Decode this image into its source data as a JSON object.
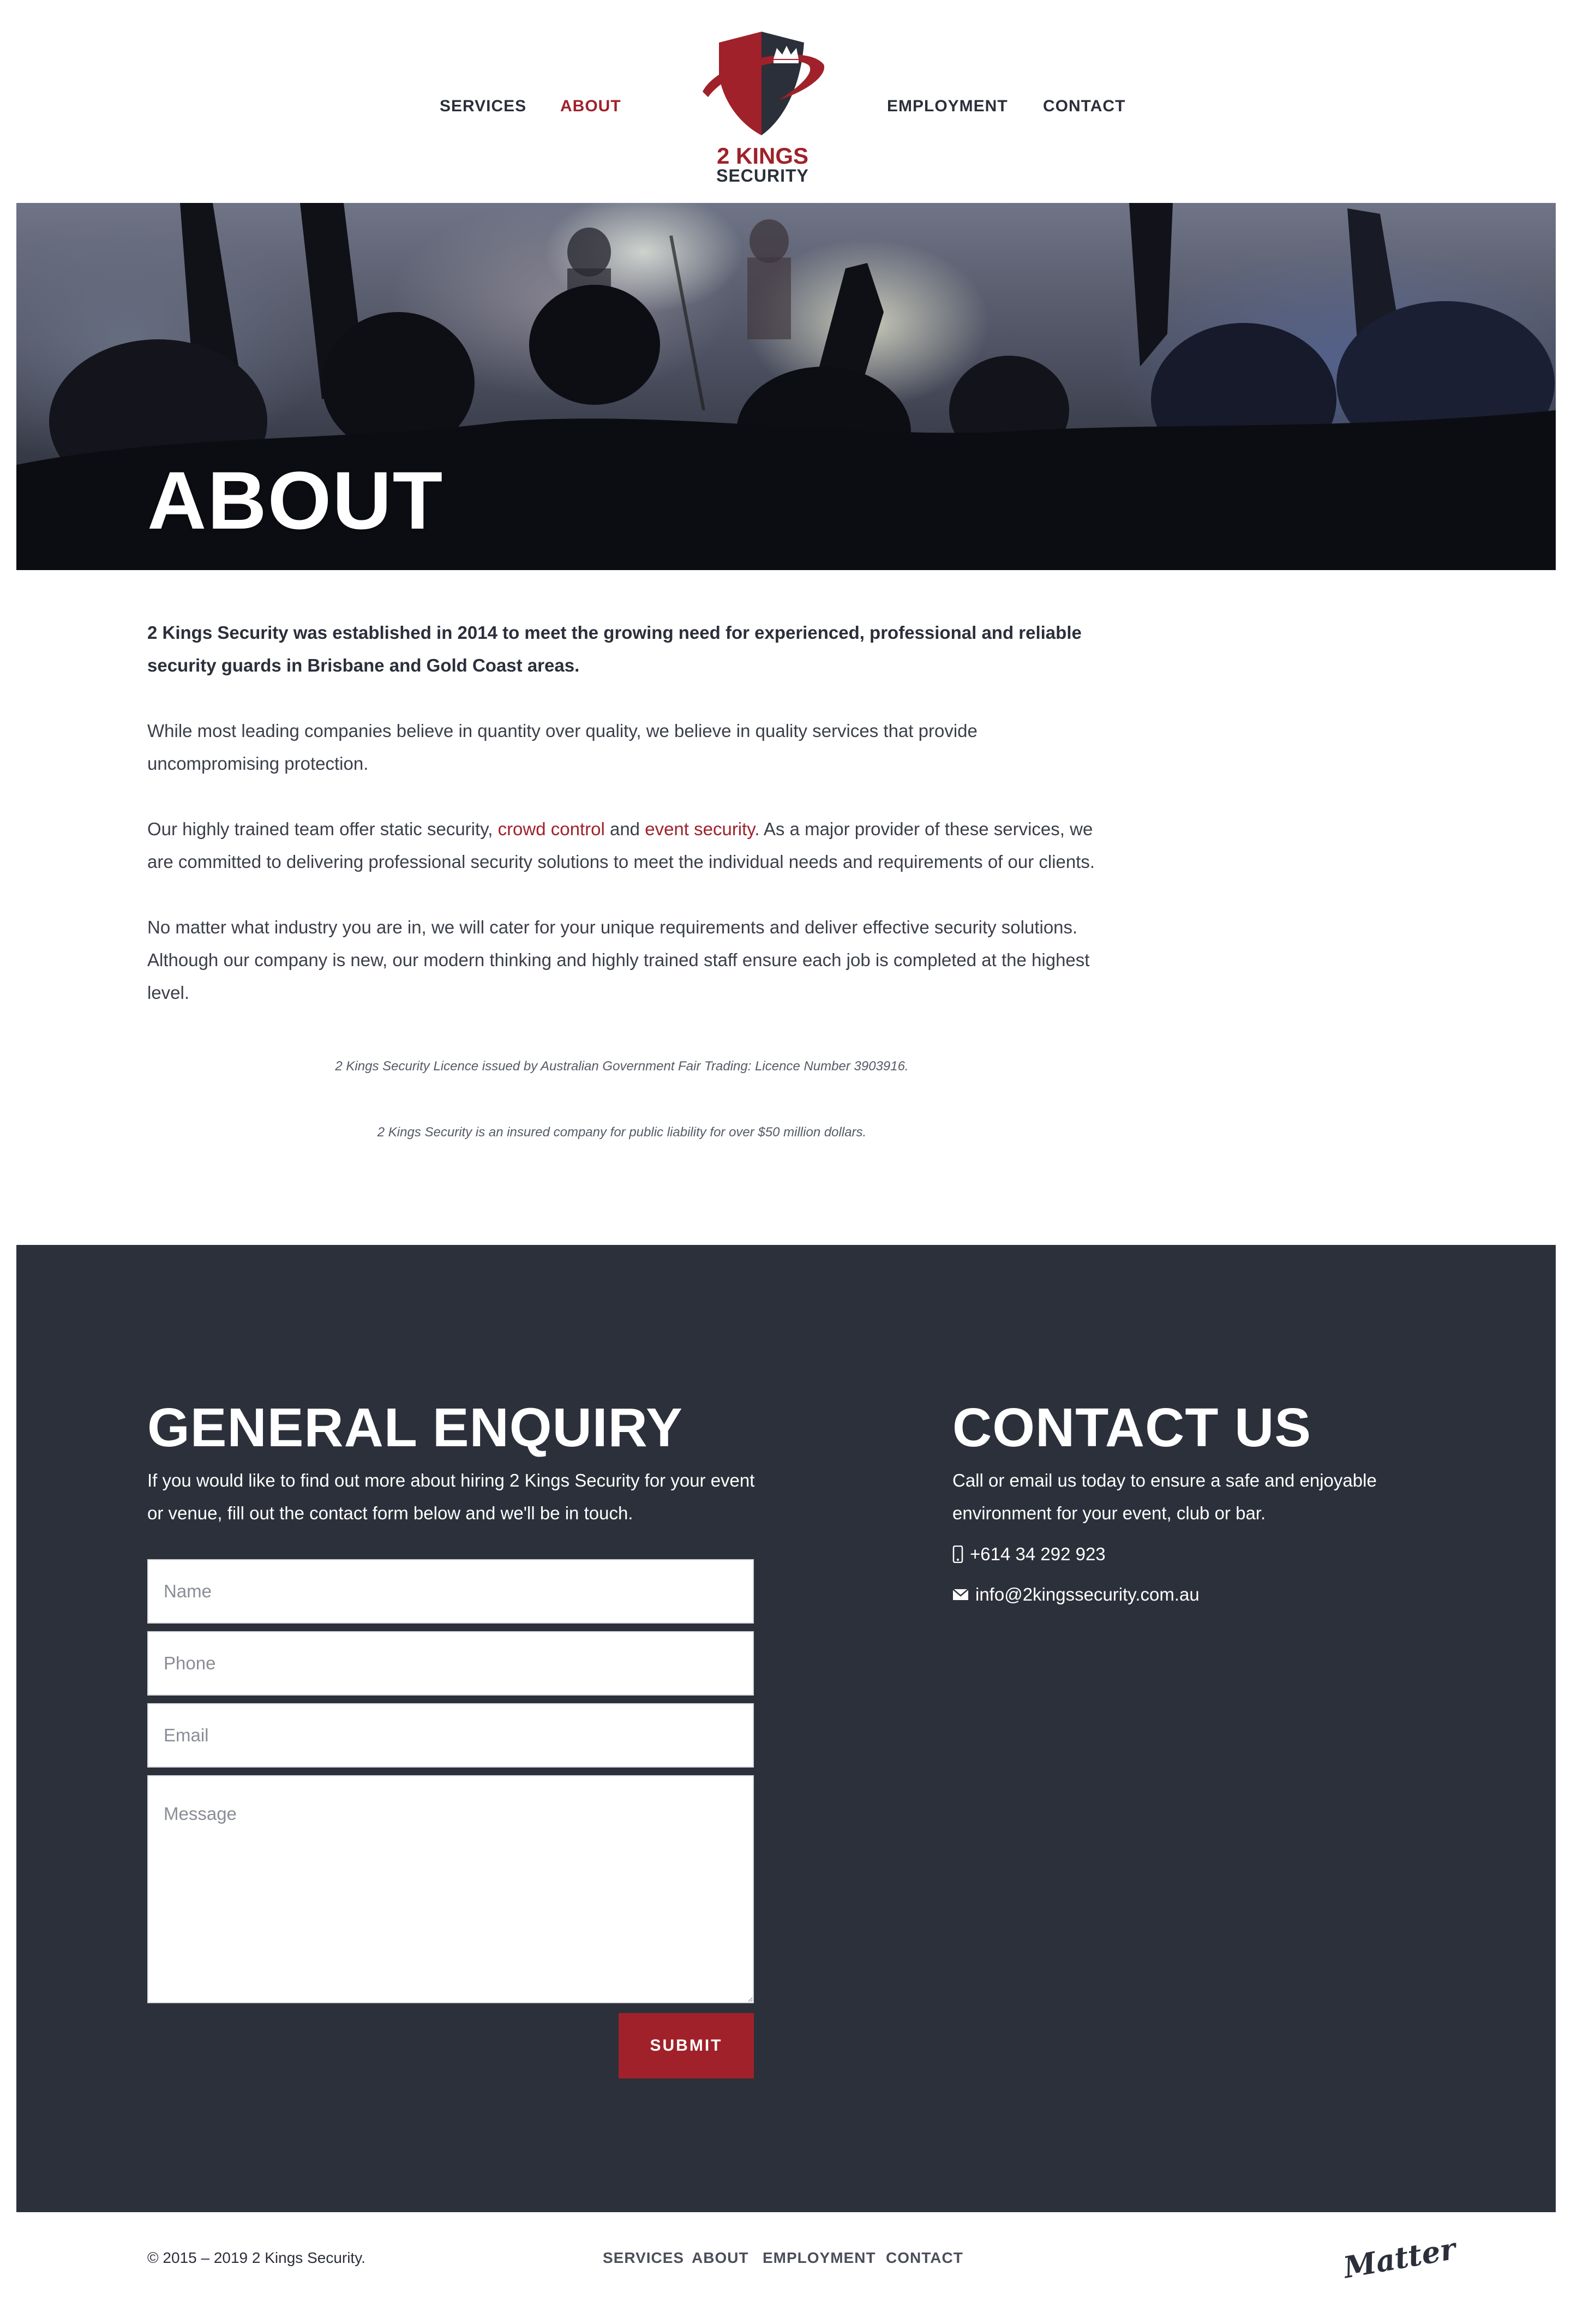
{
  "nav": {
    "items": [
      {
        "label": "SERVICES"
      },
      {
        "label": "ABOUT"
      },
      {
        "label": "EMPLOYMENT"
      },
      {
        "label": "CONTACT"
      }
    ],
    "active": "ABOUT"
  },
  "logo": {
    "line1": "2 KINGS",
    "line2": "SECURITY"
  },
  "hero": {
    "title": "ABOUT"
  },
  "content": {
    "lead": "2 Kings Security was established in 2014 to meet the growing need for experienced, professional and reliable security guards in Brisbane and Gold Coast areas.",
    "p1": "While most leading companies believe in quantity over quality, we believe in quality services that provide uncompromising protection.",
    "p2_before": "Our highly trained team offer static security, ",
    "p2_link1": "crowd control",
    "p2_between": " and ",
    "p2_link2": "event security",
    "p2_after": ". As a major provider of these services, we are committed to delivering professional security solutions to meet the individual needs and requirements of our clients.",
    "p3": "No matter what industry you are in, we will cater for your unique requirements and deliver effective security solutions. Although our company is new, our modern thinking and highly trained staff ensure each job is completed at the highest level.",
    "licence": "2 Kings Security Licence issued by Australian Government Fair Trading: Licence Number 3903916.",
    "insurance": "2 Kings Security is an insured company for public liability for over $50 million dollars."
  },
  "enquiry": {
    "title": "GENERAL ENQUIRY",
    "text": "If you would like to find out more about hiring 2 Kings Security for your event or venue, fill out the contact form below and we'll be in touch.",
    "placeholders": {
      "name": "Name",
      "phone": "Phone",
      "email": "Email",
      "message": "Message"
    },
    "submit_label": "SUBMIT"
  },
  "contact": {
    "title": "CONTACT US",
    "text": "Call or email us today to ensure a safe and enjoyable environment for your event, club or bar.",
    "phone": "+614 34 292 923",
    "email": "info@2kingssecurity.com.au"
  },
  "footer": {
    "copyright": "© 2015 – 2019 2 Kings Security.",
    "links": [
      {
        "label": "SERVICES"
      },
      {
        "label": "ABOUT"
      },
      {
        "label": "EMPLOYMENT"
      },
      {
        "label": "CONTACT"
      }
    ],
    "credit": "Matter"
  },
  "colors": {
    "accent": "#a0212a",
    "dark": "#2c303b",
    "text": "#2b2f3a"
  }
}
